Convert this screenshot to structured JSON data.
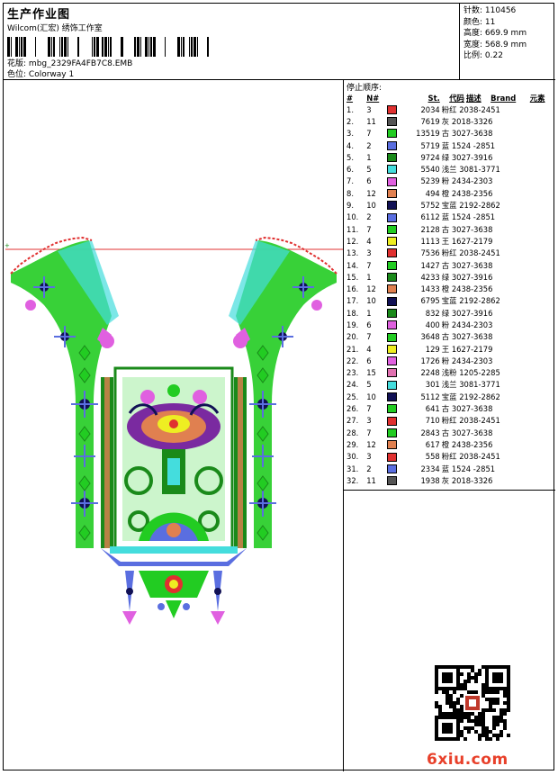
{
  "header": {
    "title": "生产作业图",
    "subtitle": "Wilcom(汇宏) 绣饰工作室",
    "design_label": "花版:",
    "design_value": "mbg_2329FA4FB7C8.EMB",
    "colorway_label": "色位:",
    "colorway_value": "Colorway 1"
  },
  "specs": [
    {
      "label": "针数:",
      "value": "110456"
    },
    {
      "label": "颜色:",
      "value": "11"
    },
    {
      "label": "高度:",
      "value": "669.9 mm"
    },
    {
      "label": "宽度:",
      "value": "568.9 mm"
    },
    {
      "label": "比例:",
      "value": "0.22"
    }
  ],
  "stop_sequence": {
    "title": "停止顺序:",
    "columns": [
      "#",
      "N#",
      "St.",
      "代码",
      "描述",
      "Brand",
      "元素"
    ],
    "rows": [
      {
        "idx": "1.",
        "n": "3",
        "color": "#e03030",
        "st": "2034",
        "desc": "粉红",
        "code": "2038-2451"
      },
      {
        "idx": "2.",
        "n": "11",
        "color": "#555555",
        "st": "7619",
        "desc": "灰",
        "code": "2018-3326"
      },
      {
        "idx": "3.",
        "n": "7",
        "color": "#22cc22",
        "st": "13519",
        "desc": "古",
        "code": "3027-3638"
      },
      {
        "idx": "4.",
        "n": "2",
        "color": "#5a6ee0",
        "st": "5719",
        "desc": "蓝",
        "code": "1524 -2851"
      },
      {
        "idx": "5.",
        "n": "1",
        "color": "#1a8a1a",
        "st": "9724",
        "desc": "绿",
        "code": "3027-3916"
      },
      {
        "idx": "6.",
        "n": "5",
        "color": "#44dddd",
        "st": "5540",
        "desc": "浅兰",
        "code": "3081-3771"
      },
      {
        "idx": "7.",
        "n": "6",
        "color": "#e060e0",
        "st": "5239",
        "desc": "粉",
        "code": "2434-2303"
      },
      {
        "idx": "8.",
        "n": "12",
        "color": "#e08050",
        "st": "494",
        "desc": "橙",
        "code": "2438-2356"
      },
      {
        "idx": "9.",
        "n": "10",
        "color": "#111155",
        "st": "5752",
        "desc": "宝蓝",
        "code": "2192-2862"
      },
      {
        "idx": "10.",
        "n": "2",
        "color": "#5a6ee0",
        "st": "6112",
        "desc": "蓝",
        "code": "1524 -2851"
      },
      {
        "idx": "11.",
        "n": "7",
        "color": "#22cc22",
        "st": "2128",
        "desc": "古",
        "code": "3027-3638"
      },
      {
        "idx": "12.",
        "n": "4",
        "color": "#eeee22",
        "st": "1113",
        "desc": "王",
        "code": "1627-2179"
      },
      {
        "idx": "13.",
        "n": "3",
        "color": "#e03030",
        "st": "7536",
        "desc": "粉红",
        "code": "2038-2451"
      },
      {
        "idx": "14.",
        "n": "7",
        "color": "#22cc22",
        "st": "1427",
        "desc": "古",
        "code": "3027-3638"
      },
      {
        "idx": "15.",
        "n": "1",
        "color": "#1a8a1a",
        "st": "4233",
        "desc": "绿",
        "code": "3027-3916"
      },
      {
        "idx": "16.",
        "n": "12",
        "color": "#e08050",
        "st": "1433",
        "desc": "橙",
        "code": "2438-2356"
      },
      {
        "idx": "17.",
        "n": "10",
        "color": "#111155",
        "st": "6795",
        "desc": "宝蓝",
        "code": "2192-2862"
      },
      {
        "idx": "18.",
        "n": "1",
        "color": "#1a8a1a",
        "st": "832",
        "desc": "绿",
        "code": "3027-3916"
      },
      {
        "idx": "19.",
        "n": "6",
        "color": "#e060e0",
        "st": "400",
        "desc": "粉",
        "code": "2434-2303"
      },
      {
        "idx": "20.",
        "n": "7",
        "color": "#22cc22",
        "st": "3648",
        "desc": "古",
        "code": "3027-3638"
      },
      {
        "idx": "21.",
        "n": "4",
        "color": "#eeee22",
        "st": "129",
        "desc": "王",
        "code": "1627-2179"
      },
      {
        "idx": "22.",
        "n": "6",
        "color": "#e060e0",
        "st": "1726",
        "desc": "粉",
        "code": "2434-2303"
      },
      {
        "idx": "23.",
        "n": "15",
        "color": "#e070b0",
        "st": "2248",
        "desc": "浅粉",
        "code": "1205-2285"
      },
      {
        "idx": "24.",
        "n": "5",
        "color": "#44dddd",
        "st": "301",
        "desc": "浅兰",
        "code": "3081-3771"
      },
      {
        "idx": "25.",
        "n": "10",
        "color": "#111155",
        "st": "5112",
        "desc": "宝蓝",
        "code": "2192-2862"
      },
      {
        "idx": "26.",
        "n": "7",
        "color": "#22cc22",
        "st": "641",
        "desc": "古",
        "code": "3027-3638"
      },
      {
        "idx": "27.",
        "n": "3",
        "color": "#e03030",
        "st": "710",
        "desc": "粉红",
        "code": "2038-2451"
      },
      {
        "idx": "28.",
        "n": "7",
        "color": "#22cc22",
        "st": "2843",
        "desc": "古",
        "code": "3027-3638"
      },
      {
        "idx": "29.",
        "n": "12",
        "color": "#e08050",
        "st": "617",
        "desc": "橙",
        "code": "2438-2356"
      },
      {
        "idx": "30.",
        "n": "3",
        "color": "#e03030",
        "st": "558",
        "desc": "粉红",
        "code": "2038-2451"
      },
      {
        "idx": "31.",
        "n": "2",
        "color": "#5a6ee0",
        "st": "2334",
        "desc": "蓝",
        "code": "1524 -2851"
      },
      {
        "idx": "32.",
        "n": "11",
        "color": "#555555",
        "st": "1938",
        "desc": "灰",
        "code": "2018-3326"
      }
    ]
  },
  "watermark": "6xiu.com",
  "colors": {
    "green": "#22cc22",
    "dark_green": "#1a8a1a",
    "cyan": "#44dddd",
    "blue": "#5a6ee0",
    "navy": "#111155",
    "magenta": "#e060e0",
    "red": "#e03030",
    "orange": "#e08050",
    "yellow": "#eeee22",
    "purple": "#7a2aa0"
  }
}
